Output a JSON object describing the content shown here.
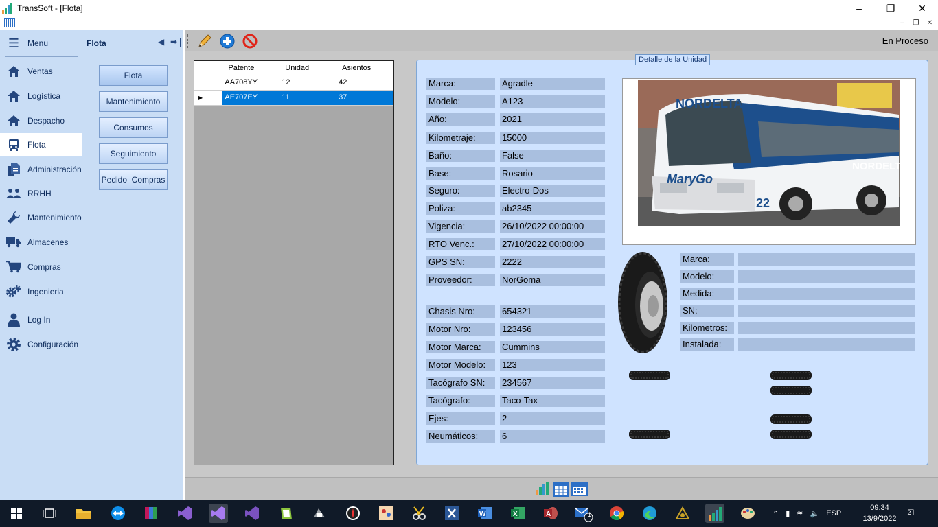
{
  "window": {
    "title": "TransSoft - [Flota]"
  },
  "sidebar": {
    "items": [
      {
        "label": "Menu",
        "icon": "hamburger-icon"
      },
      {
        "label": "Ventas",
        "icon": "home-icon"
      },
      {
        "label": "Logística",
        "icon": "home-icon"
      },
      {
        "label": "Despacho",
        "icon": "home-icon"
      },
      {
        "label": "Flota",
        "icon": "bus-icon"
      },
      {
        "label": "Administración",
        "icon": "document-icon"
      },
      {
        "label": "RRHH",
        "icon": "users-icon"
      },
      {
        "label": "Mantenimiento",
        "icon": "wrench-icon"
      },
      {
        "label": "Almacenes",
        "icon": "truck-icon"
      },
      {
        "label": "Compras",
        "icon": "cart-icon"
      },
      {
        "label": "Ingenieria",
        "icon": "gears-icon"
      },
      {
        "label": "Log In",
        "icon": "user-icon"
      },
      {
        "label": "Configuración",
        "icon": "gear-icon"
      }
    ]
  },
  "subpanel": {
    "title": "Flota",
    "buttons": [
      "Flota",
      "Mantenimiento",
      "Consumos",
      "Seguimiento",
      "Pedido  Compras"
    ]
  },
  "toolbar": {
    "status": "En Proceso"
  },
  "grid": {
    "columns": [
      "Patente",
      "Unidad",
      "Asientos"
    ],
    "rows": [
      {
        "patente": "AA708YY",
        "unidad": "12",
        "asientos": "42"
      },
      {
        "patente": "AE707EY",
        "unidad": "11",
        "asientos": "37"
      }
    ],
    "selected_index": 1
  },
  "detail": {
    "legend": "Detalle de la Unidad",
    "fields": [
      {
        "label": "Marca:",
        "value": "Agradle"
      },
      {
        "label": "Modelo:",
        "value": "A123"
      },
      {
        "label": "Año:",
        "value": "2021"
      },
      {
        "label": "Kilometraje:",
        "value": "15000"
      },
      {
        "label": "Baño:",
        "value": "False"
      },
      {
        "label": "Base:",
        "value": "Rosario"
      },
      {
        "label": "Seguro:",
        "value": "Electro-Dos"
      },
      {
        "label": "Poliza:",
        "value": "ab2345"
      },
      {
        "label": "Vigencia:",
        "value": "26/10/2022 00:00:00"
      },
      {
        "label": "RTO Venc.:",
        "value": "27/10/2022 00:00:00"
      },
      {
        "label": "GPS SN:",
        "value": "2222"
      },
      {
        "label": "Proveedor:",
        "value": "NorGoma"
      }
    ],
    "fields2": [
      {
        "label": "Chasis Nro:",
        "value": "654321"
      },
      {
        "label": "Motor Nro:",
        "value": "123456"
      },
      {
        "label": "Motor Marca:",
        "value": "Cummins"
      },
      {
        "label": "Motor Modelo:",
        "value": "123"
      },
      {
        "label": "Tacógrafo SN:",
        "value": "234567"
      },
      {
        "label": "Tacógrafo:",
        "value": "Taco-Tax"
      },
      {
        "label": "Ejes:",
        "value": "2"
      },
      {
        "label": "Neumáticos:",
        "value": "6"
      }
    ],
    "photo": {
      "brand_text": "NORDELTA",
      "logo_text": "MaryGo",
      "number": "22"
    },
    "tire_fields": [
      {
        "label": "Marca:",
        "value": ""
      },
      {
        "label": "Modelo:",
        "value": ""
      },
      {
        "label": "Medida:",
        "value": ""
      },
      {
        "label": "SN:",
        "value": ""
      },
      {
        "label": "Kilometros:",
        "value": ""
      },
      {
        "label": "Instalada:",
        "value": ""
      }
    ]
  },
  "taskbar": {
    "tray": {
      "lang": "ESP",
      "time": "09:34",
      "date": "13/9/2022",
      "notifications": "2",
      "mail_badge": "1"
    }
  },
  "colors": {
    "selection": "#0078d7",
    "panel": "#cfe3ff",
    "sidebar": "#c9ddf5",
    "field_bg": "#a9bfdf"
  }
}
